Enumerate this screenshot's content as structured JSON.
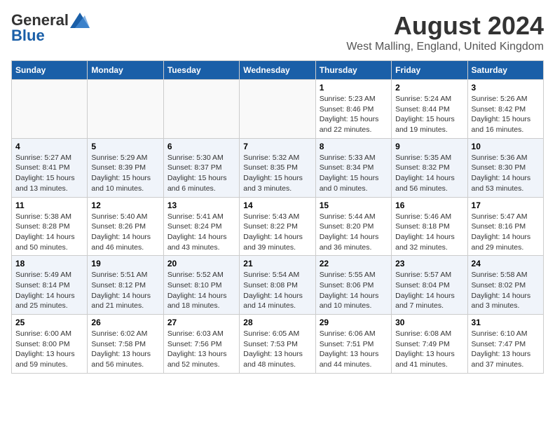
{
  "header": {
    "logo_general": "General",
    "logo_blue": "Blue",
    "month_year": "August 2024",
    "location": "West Malling, England, United Kingdom"
  },
  "calendar": {
    "days_of_week": [
      "Sunday",
      "Monday",
      "Tuesday",
      "Wednesday",
      "Thursday",
      "Friday",
      "Saturday"
    ],
    "weeks": [
      [
        {
          "day": "",
          "info": ""
        },
        {
          "day": "",
          "info": ""
        },
        {
          "day": "",
          "info": ""
        },
        {
          "day": "",
          "info": ""
        },
        {
          "day": "1",
          "info": "Sunrise: 5:23 AM\nSunset: 8:46 PM\nDaylight: 15 hours\nand 22 minutes."
        },
        {
          "day": "2",
          "info": "Sunrise: 5:24 AM\nSunset: 8:44 PM\nDaylight: 15 hours\nand 19 minutes."
        },
        {
          "day": "3",
          "info": "Sunrise: 5:26 AM\nSunset: 8:42 PM\nDaylight: 15 hours\nand 16 minutes."
        }
      ],
      [
        {
          "day": "4",
          "info": "Sunrise: 5:27 AM\nSunset: 8:41 PM\nDaylight: 15 hours\nand 13 minutes."
        },
        {
          "day": "5",
          "info": "Sunrise: 5:29 AM\nSunset: 8:39 PM\nDaylight: 15 hours\nand 10 minutes."
        },
        {
          "day": "6",
          "info": "Sunrise: 5:30 AM\nSunset: 8:37 PM\nDaylight: 15 hours\nand 6 minutes."
        },
        {
          "day": "7",
          "info": "Sunrise: 5:32 AM\nSunset: 8:35 PM\nDaylight: 15 hours\nand 3 minutes."
        },
        {
          "day": "8",
          "info": "Sunrise: 5:33 AM\nSunset: 8:34 PM\nDaylight: 15 hours\nand 0 minutes."
        },
        {
          "day": "9",
          "info": "Sunrise: 5:35 AM\nSunset: 8:32 PM\nDaylight: 14 hours\nand 56 minutes."
        },
        {
          "day": "10",
          "info": "Sunrise: 5:36 AM\nSunset: 8:30 PM\nDaylight: 14 hours\nand 53 minutes."
        }
      ],
      [
        {
          "day": "11",
          "info": "Sunrise: 5:38 AM\nSunset: 8:28 PM\nDaylight: 14 hours\nand 50 minutes."
        },
        {
          "day": "12",
          "info": "Sunrise: 5:40 AM\nSunset: 8:26 PM\nDaylight: 14 hours\nand 46 minutes."
        },
        {
          "day": "13",
          "info": "Sunrise: 5:41 AM\nSunset: 8:24 PM\nDaylight: 14 hours\nand 43 minutes."
        },
        {
          "day": "14",
          "info": "Sunrise: 5:43 AM\nSunset: 8:22 PM\nDaylight: 14 hours\nand 39 minutes."
        },
        {
          "day": "15",
          "info": "Sunrise: 5:44 AM\nSunset: 8:20 PM\nDaylight: 14 hours\nand 36 minutes."
        },
        {
          "day": "16",
          "info": "Sunrise: 5:46 AM\nSunset: 8:18 PM\nDaylight: 14 hours\nand 32 minutes."
        },
        {
          "day": "17",
          "info": "Sunrise: 5:47 AM\nSunset: 8:16 PM\nDaylight: 14 hours\nand 29 minutes."
        }
      ],
      [
        {
          "day": "18",
          "info": "Sunrise: 5:49 AM\nSunset: 8:14 PM\nDaylight: 14 hours\nand 25 minutes."
        },
        {
          "day": "19",
          "info": "Sunrise: 5:51 AM\nSunset: 8:12 PM\nDaylight: 14 hours\nand 21 minutes."
        },
        {
          "day": "20",
          "info": "Sunrise: 5:52 AM\nSunset: 8:10 PM\nDaylight: 14 hours\nand 18 minutes."
        },
        {
          "day": "21",
          "info": "Sunrise: 5:54 AM\nSunset: 8:08 PM\nDaylight: 14 hours\nand 14 minutes."
        },
        {
          "day": "22",
          "info": "Sunrise: 5:55 AM\nSunset: 8:06 PM\nDaylight: 14 hours\nand 10 minutes."
        },
        {
          "day": "23",
          "info": "Sunrise: 5:57 AM\nSunset: 8:04 PM\nDaylight: 14 hours\nand 7 minutes."
        },
        {
          "day": "24",
          "info": "Sunrise: 5:58 AM\nSunset: 8:02 PM\nDaylight: 14 hours\nand 3 minutes."
        }
      ],
      [
        {
          "day": "25",
          "info": "Sunrise: 6:00 AM\nSunset: 8:00 PM\nDaylight: 13 hours\nand 59 minutes."
        },
        {
          "day": "26",
          "info": "Sunrise: 6:02 AM\nSunset: 7:58 PM\nDaylight: 13 hours\nand 56 minutes."
        },
        {
          "day": "27",
          "info": "Sunrise: 6:03 AM\nSunset: 7:56 PM\nDaylight: 13 hours\nand 52 minutes."
        },
        {
          "day": "28",
          "info": "Sunrise: 6:05 AM\nSunset: 7:53 PM\nDaylight: 13 hours\nand 48 minutes."
        },
        {
          "day": "29",
          "info": "Sunrise: 6:06 AM\nSunset: 7:51 PM\nDaylight: 13 hours\nand 44 minutes."
        },
        {
          "day": "30",
          "info": "Sunrise: 6:08 AM\nSunset: 7:49 PM\nDaylight: 13 hours\nand 41 minutes."
        },
        {
          "day": "31",
          "info": "Sunrise: 6:10 AM\nSunset: 7:47 PM\nDaylight: 13 hours\nand 37 minutes."
        }
      ]
    ]
  }
}
